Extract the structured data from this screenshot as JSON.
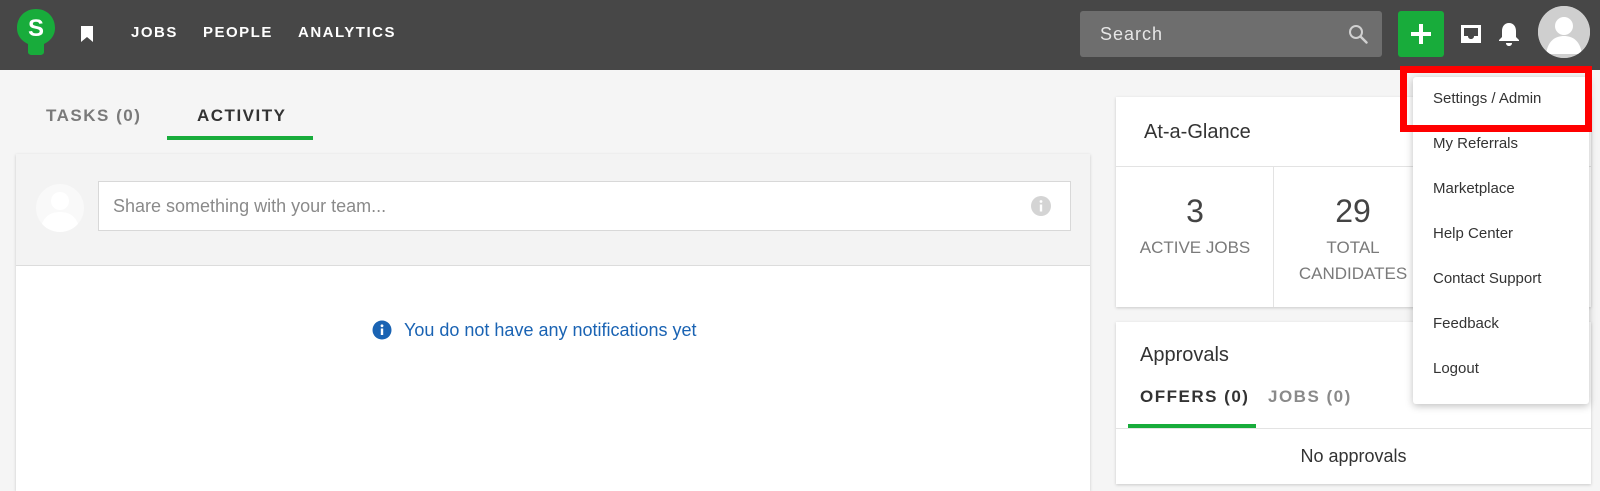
{
  "topbar": {
    "logo_letter": "S",
    "nav": [
      "JOBS",
      "PEOPLE",
      "ANALYTICS"
    ],
    "search_placeholder": "Search"
  },
  "tabs": [
    "TASKS (0)",
    "ACTIVITY"
  ],
  "composer": {
    "placeholder": "Share something with your team..."
  },
  "notifications_empty": "You do not have any notifications yet",
  "glance": {
    "title": "At-a-Glance",
    "stats": [
      {
        "value": "3",
        "label": "ACTIVE JOBS"
      },
      {
        "value": "29",
        "label_line1": "TOTAL",
        "label_line2": "CANDIDATES"
      }
    ]
  },
  "approvals": {
    "title": "Approvals",
    "tabs": [
      "OFFERS (0)",
      "JOBS (0)"
    ],
    "empty": "No approvals"
  },
  "menu": {
    "items": [
      "Settings / Admin",
      "My Referrals",
      "Marketplace",
      "Help Center",
      "Contact Support",
      "Feedback",
      "Logout"
    ]
  },
  "colors": {
    "topbar": "#474747",
    "brand_green": "#18ac3b",
    "link_blue": "#1a63b3",
    "highlight": "#ff0000"
  }
}
